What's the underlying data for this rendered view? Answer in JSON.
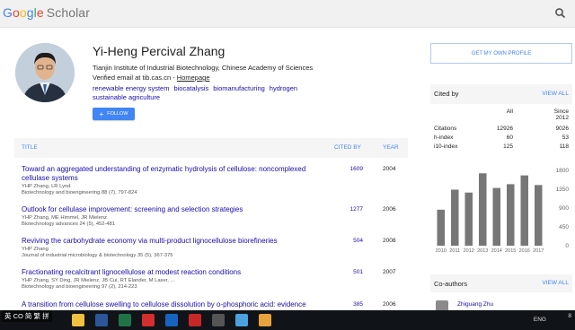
{
  "header": {
    "logo_letters": [
      "G",
      "o",
      "o",
      "g",
      "l",
      "e"
    ],
    "logo_suffix": "Scholar",
    "search_icon": "search-icon"
  },
  "profile": {
    "name": "Yi-Heng Percival Zhang",
    "affiliation": "Tianjin Institute of Industrial Biotechnology, Chinese Academy of Sciences",
    "email_text": "Verified email at tib.cas.cn - ",
    "homepage_label": "Homepage",
    "interests": [
      "renewable energy system",
      "biocatalysis",
      "biomanufacturing",
      "hydrogen",
      "sustainable agriculture"
    ],
    "follow_label": "FOLLOW",
    "follow_icon": "plus-icon"
  },
  "table": {
    "col_title": "TITLE",
    "col_cited": "CITED BY",
    "col_year": "YEAR",
    "rows": [
      {
        "title": "Toward an aggregated understanding of enzymatic hydrolysis of cellulose: noncomplexed cellulase systems",
        "authors": "YHP Zhang, LR Lynd",
        "venue": "Biotechnology and bioengineering 88 (7), 797-824",
        "cited": "1609",
        "year": "2004"
      },
      {
        "title": "Outlook for cellulase improvement: screening and selection strategies",
        "authors": "YHP Zhang, ME Himmel, JR Mielenz",
        "venue": "Biotechnology advances 24 (5), 452-481",
        "cited": "1277",
        "year": "2006"
      },
      {
        "title": "Reviving the carbohydrate economy via multi-product lignocellulose biorefineries",
        "authors": "YHP Zhang",
        "venue": "Journal of industrial microbiology & biotechnology 35 (5), 367-375",
        "cited": "504",
        "year": "2008"
      },
      {
        "title": "Fractionating recalcitrant lignocellulose at modest reaction conditions",
        "authors": "YHP Zhang, SY Ding, JR Mielenz, JB Cui, RT Elander, M Laser, ...",
        "venue": "Biotechnology and bioengineering 97 (2), 214-223",
        "cited": "501",
        "year": "2007"
      },
      {
        "title": "A transition from cellulose swelling to cellulose dissolution by o-phosphoric acid: evidence",
        "authors": "",
        "venue": "",
        "cited": "385",
        "year": "2006"
      }
    ]
  },
  "sidebar": {
    "own_profile_label": "GET MY OWN PROFILE",
    "cited_by_label": "Cited by",
    "view_all_label": "VIEW ALL",
    "stats_cols": [
      "All",
      "Since 2012"
    ],
    "stats": [
      {
        "k": "Citations",
        "all": "12926",
        "since": "9026"
      },
      {
        "k": "h-index",
        "all": "60",
        "since": "53"
      },
      {
        "k": "i10-index",
        "all": "125",
        "since": "118"
      }
    ],
    "coauthors_label": "Co-authors",
    "coauthor_view_all": "VIEW ALL",
    "coauthors": [
      "Zhiguang Zhu"
    ]
  },
  "chart_data": {
    "type": "bar",
    "categories": [
      "2010",
      "2011",
      "2012",
      "2013",
      "2014",
      "2015",
      "2016",
      "2017"
    ],
    "values": [
      860,
      1340,
      1270,
      1730,
      1380,
      1470,
      1680,
      1450
    ],
    "yticks": [
      "1800",
      "1350",
      "900",
      "450",
      "0"
    ],
    "ylim": [
      0,
      1800
    ],
    "bar_color": "#777777"
  },
  "taskbar": {
    "ime_label": "英 CO 简 繁 拼",
    "apps": [
      {
        "name": "file-explorer-icon",
        "color": "#f0c040"
      },
      {
        "name": "word-icon",
        "color": "#2b579a"
      },
      {
        "name": "excel-icon",
        "color": "#217346"
      },
      {
        "name": "pdf-icon",
        "color": "#d32f2f"
      },
      {
        "name": "app-icon",
        "color": "#1565c0"
      },
      {
        "name": "mendeley-icon",
        "color": "#c62828"
      },
      {
        "name": "zotero-icon",
        "color": "#555555"
      },
      {
        "name": "app-icon",
        "color": "#4aa3df"
      },
      {
        "name": "chrome-icon",
        "color": "#e8a33c"
      }
    ],
    "lang": "ENG",
    "clock": "8"
  }
}
